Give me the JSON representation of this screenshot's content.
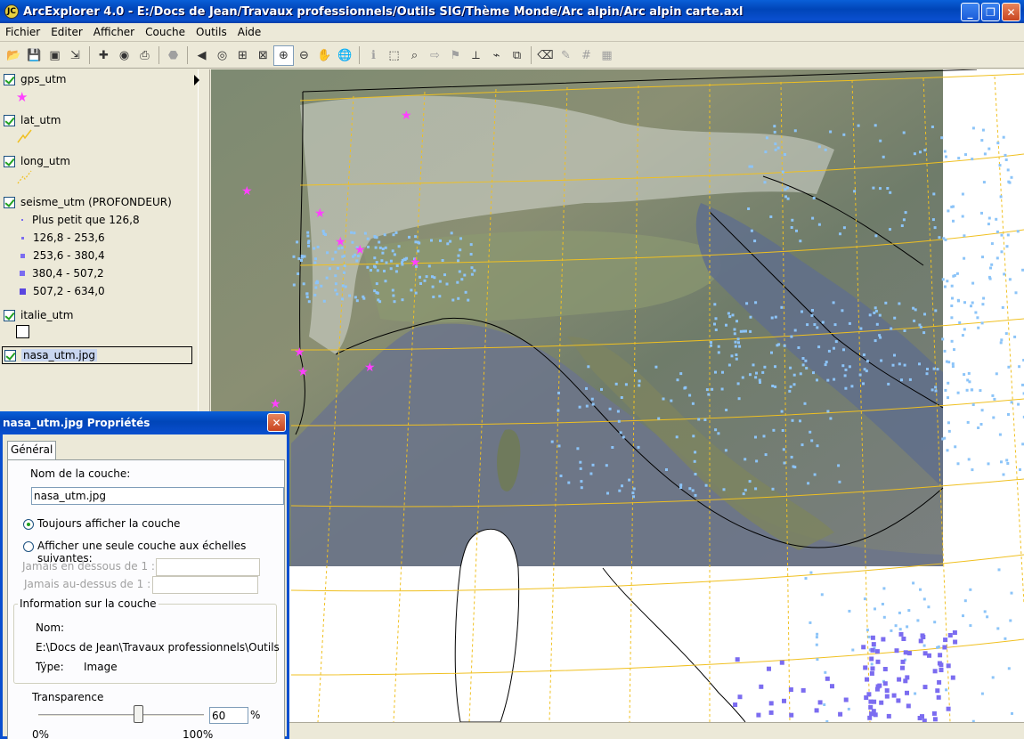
{
  "window": {
    "title": "ArcExplorer 4.0 - E:/Docs de Jean/Travaux professionnels/Outils SIG/Thème Monde/Arc alpin/Arc alpin carte.axl",
    "minimize": "_",
    "maximize": "❐",
    "close": "✕"
  },
  "menu": [
    "Fichier",
    "Editer",
    "Afficher",
    "Couche",
    "Outils",
    "Aide"
  ],
  "toolbar_icons": [
    "open-folder-icon",
    "save-icon",
    "save-all-icon",
    "export-icon",
    "add-layer-icon",
    "add-image-icon",
    "print-icon",
    "stop-icon",
    "previous-extent-icon",
    "full-extent-icon",
    "zoom-to-layer-icon",
    "zoom-to-selected-icon",
    "zoom-in-icon",
    "zoom-out-icon",
    "pan-hand-icon",
    "globe-icon",
    "identify-icon",
    "select-rectangle-icon",
    "find-binoculars-icon",
    "attribute-query-icon",
    "buffer-icon",
    "measure-icon",
    "hyperlink-icon",
    "overview-icon",
    "eraser-icon",
    "clear-selection-icon",
    "grid-icon",
    "table-icon"
  ],
  "layers": [
    {
      "name": "gps_utm",
      "checked": true
    },
    {
      "name": "lat_utm",
      "checked": true
    },
    {
      "name": "long_utm",
      "checked": true
    },
    {
      "name": "seisme_utm (PROFONDEUR)",
      "checked": true
    },
    {
      "name": "italie_utm",
      "checked": true
    },
    {
      "name": "nasa_utm.jpg",
      "checked": true
    }
  ],
  "legend": [
    "Plus petit que 126,8",
    "126,8 - 253,6",
    "253,6 - 380,4",
    "380,4 - 507,2",
    "507,2 - 634,0"
  ],
  "colors": {
    "star": "#ff40ff",
    "grid": "#f0c020",
    "quake_light": "#8cc4f8",
    "quake_deep": "#7b6cf0",
    "coast": "#000000"
  },
  "dialog": {
    "title": "nasa_utm.jpg Propriétés",
    "close": "✕",
    "tab": "Général",
    "layer_name_label": "Nom de la couche:",
    "layer_name_value": "nasa_utm.jpg",
    "radio_always": "Toujours afficher la couche",
    "radio_scales": "Afficher une seule couche aux échelles suivantes:",
    "min_scale_label": "Jamais en dessous de 1 :",
    "max_scale_label": "Jamais au-dessus de 1 :",
    "info_group": "Information sur la couche",
    "nom_label": "Nom:",
    "path_value": "E:\\Docs de Jean\\Travaux professionnels\\Outils ...",
    "type_label": "Type:",
    "type_value": "Image",
    "transparency_label": "Transparence",
    "transparency_value": "60",
    "percent_sign": "%",
    "slider_min": "0%",
    "slider_max": "100%"
  }
}
